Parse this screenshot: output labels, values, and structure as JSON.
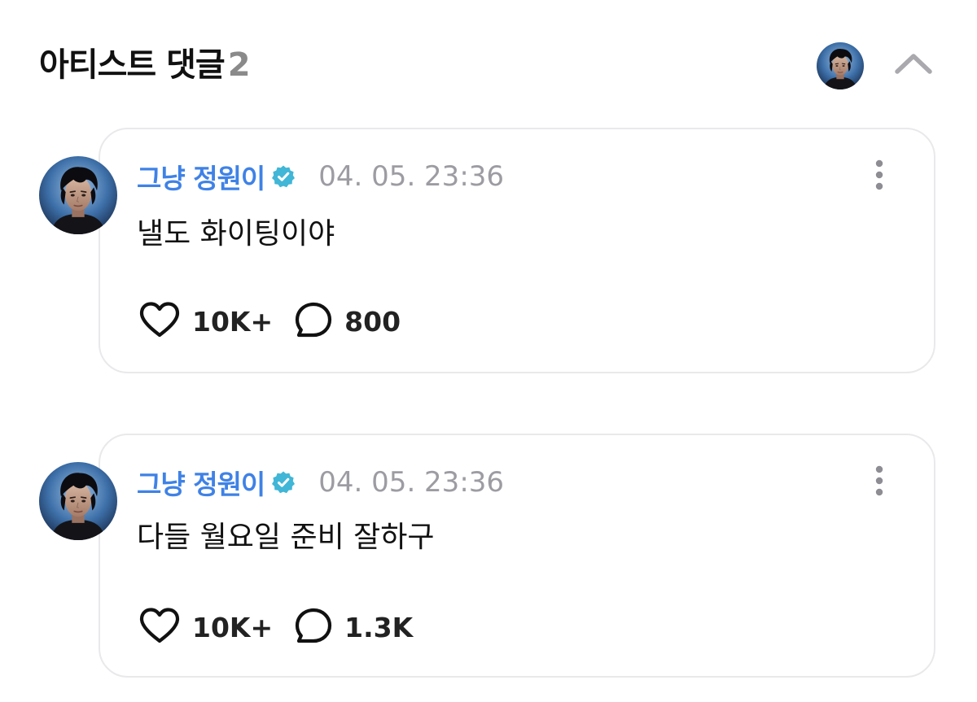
{
  "header": {
    "title": "아티스트 댓글",
    "count": "2"
  },
  "icons": {
    "collapse": "chevron-up-icon",
    "verified": "verified-badge-icon",
    "more": "more-vertical-icon",
    "like": "heart-icon",
    "reply": "speech-bubble-icon"
  },
  "colors": {
    "author": "#3f82e6",
    "verified_badge": "#41b6d6",
    "timestamp": "#9c9ca2",
    "card_border": "#e9e9ec"
  },
  "comments": [
    {
      "author": "그냥 정원이",
      "timestamp": "04. 05. 23:36",
      "text": "낼도 화이팅이야",
      "likes": "10K+",
      "replies": "800"
    },
    {
      "author": "그냥 정원이",
      "timestamp": "04. 05. 23:36",
      "text": "다들 월요일 준비 잘하구",
      "likes": "10K+",
      "replies": "1.3K"
    }
  ]
}
